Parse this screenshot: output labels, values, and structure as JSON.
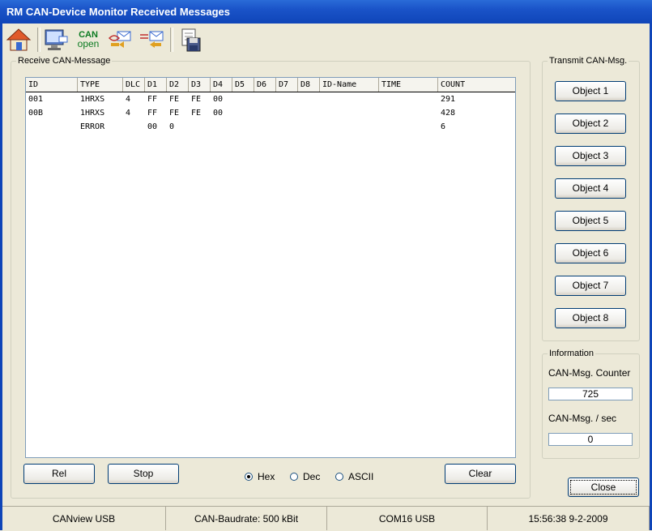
{
  "window": {
    "title": "RM CAN-Device Monitor Received Messages"
  },
  "toolbar": {
    "buttons": [
      {
        "name": "home-icon"
      },
      {
        "name": "monitor-icon"
      },
      {
        "name": "canopen-icon",
        "label_top": "CAN",
        "label_bottom": "open"
      },
      {
        "name": "send-message-icon"
      },
      {
        "name": "receive-message-icon"
      },
      {
        "name": "save-disk-icon"
      }
    ]
  },
  "receive": {
    "legend": "Receive CAN-Message",
    "columns": [
      "ID",
      "TYPE",
      "DLC",
      "D1",
      "D2",
      "D3",
      "D4",
      "D5",
      "D6",
      "D7",
      "D8",
      "ID-Name",
      "TIME",
      "COUNT"
    ],
    "rows": [
      [
        "001",
        "1HRXS",
        "4",
        "FF",
        "FE",
        "FE",
        "00",
        "",
        "",
        "",
        "",
        "",
        "",
        "291"
      ],
      [
        "00B",
        "1HRXS",
        "4",
        "FF",
        "FE",
        "FE",
        "00",
        "",
        "",
        "",
        "",
        "",
        "",
        "428"
      ],
      [
        "",
        "ERROR",
        "",
        "00",
        "0",
        "",
        "",
        "",
        "",
        "",
        "",
        "",
        "",
        "6"
      ]
    ],
    "rel_label": "Rel",
    "stop_label": "Stop",
    "clear_label": "Clear",
    "format_options": [
      "Hex",
      "Dec",
      "ASCII"
    ],
    "format_selected": "Hex"
  },
  "transmit": {
    "legend": "Transmit CAN-Msg.",
    "objects": [
      "Object 1",
      "Object 2",
      "Object 3",
      "Object 4",
      "Object 5",
      "Object 6",
      "Object 7",
      "Object 8"
    ]
  },
  "information": {
    "legend": "Information",
    "counter_label": "CAN-Msg. Counter",
    "counter_value": "725",
    "rate_label": "CAN-Msg. / sec",
    "rate_value": "0"
  },
  "close_label": "Close",
  "statusbar": {
    "device": "CANview USB",
    "baudrate": "CAN-Baudrate: 500 kBit",
    "port": "COM16  USB",
    "datetime": "15:56:38  9-2-2009"
  }
}
